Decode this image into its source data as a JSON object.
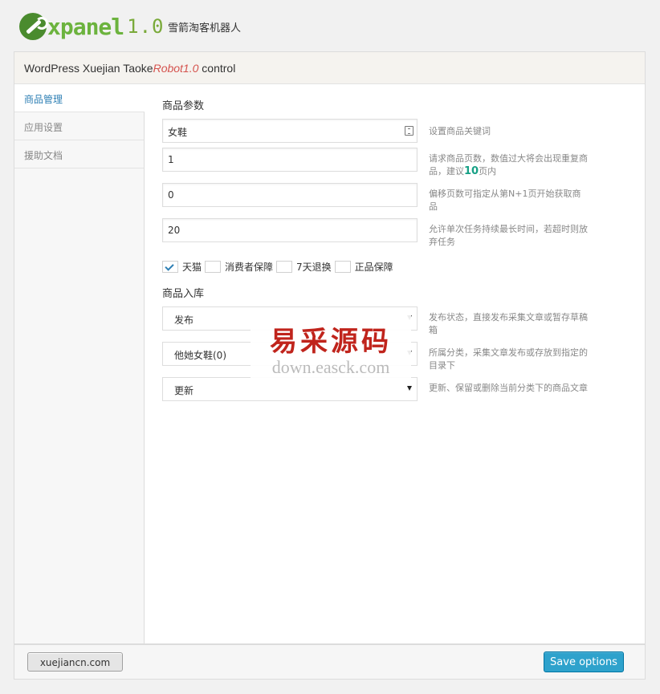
{
  "header": {
    "logo_text": "xpanel",
    "logo_version": "1.0",
    "subtitle": "雪箭淘客机器人"
  },
  "panel": {
    "title_prefix": "WordPress Xuejian Taoke",
    "title_accent": "Robot1.0",
    "title_suffix": "control"
  },
  "sidebar": {
    "items": [
      {
        "label": "商品管理",
        "active": true
      },
      {
        "label": "应用设置",
        "active": false
      },
      {
        "label": "援助文档",
        "active": false
      }
    ]
  },
  "product_params": {
    "section_title": "商品参数",
    "keyword": {
      "value": "女鞋",
      "description": "设置商品关键词"
    },
    "pages": {
      "value": "1",
      "description_1": "请求商品页数，数值过大将会出现重复商品，建议",
      "description_hl": "10",
      "description_2": "页内"
    },
    "offset": {
      "value": "0",
      "description": "偏移页数可指定从第N+1页开始获取商品"
    },
    "timeout": {
      "value": "20",
      "description": "允许单次任务持续最长时间，若超时则放弃任务"
    }
  },
  "checkboxes": [
    {
      "label": "天猫",
      "checked": true
    },
    {
      "label": "消费者保障",
      "checked": false
    },
    {
      "label": "7天退换",
      "checked": false
    },
    {
      "label": "正品保障",
      "checked": false
    }
  ],
  "storage": {
    "section_title": "商品入库",
    "status": {
      "value": "发布",
      "description": "发布状态，直接发布采集文章或暂存草稿箱"
    },
    "category": {
      "value": "他她女鞋(0)",
      "description": "所属分类，采集文章发布或存放到指定的目录下"
    },
    "action": {
      "value": "更新",
      "description": "更新、保留或删除当前分类下的商品文章"
    }
  },
  "watermark": {
    "cn": "易采源码",
    "url": "down.easck.com"
  },
  "footer": {
    "site_button": "xuejiancn.com",
    "save_button": "Save options"
  },
  "colors": {
    "accent_red": "#d5534e",
    "link_blue": "#2e7fb4",
    "save_blue": "#2ea2cc",
    "logo_green": "#6cb33e",
    "highlight_teal": "#16a085"
  }
}
